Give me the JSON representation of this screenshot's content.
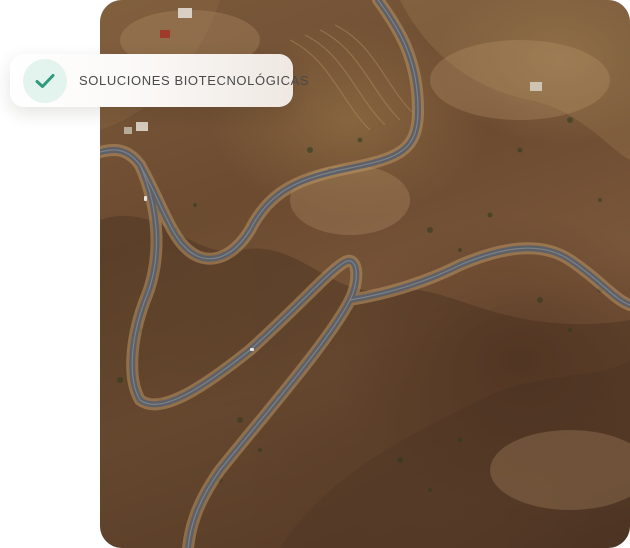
{
  "badge": {
    "label": "SOLUCIONES BIOTECNOLÓGICAS",
    "icon": "check-icon",
    "icon_color": "#2f9a7e",
    "icon_bg": "#e3f3ee"
  },
  "photo": {
    "subject": "aerial-winding-mountain-road",
    "icon": "landscape-photo"
  }
}
